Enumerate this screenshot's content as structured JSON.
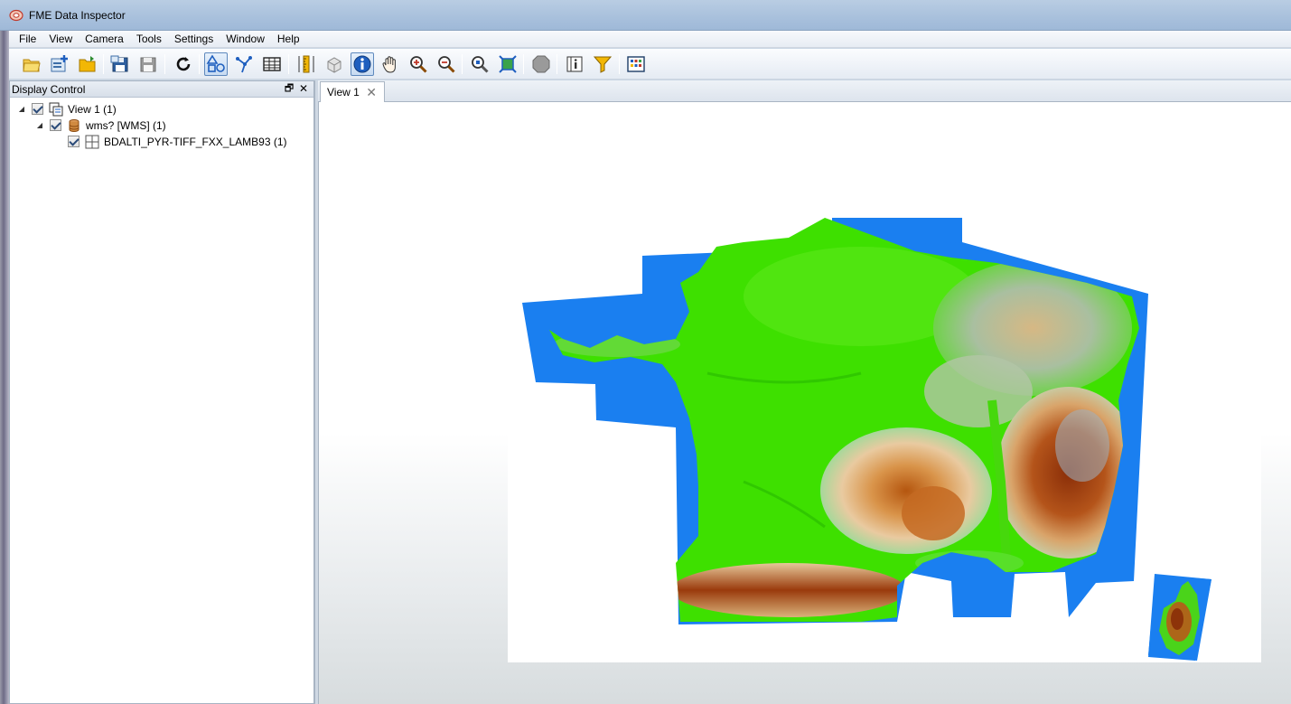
{
  "window": {
    "title": "FME Data Inspector"
  },
  "menu": {
    "items": [
      "File",
      "View",
      "Camera",
      "Tools",
      "Settings",
      "Window",
      "Help"
    ]
  },
  "toolbar": {
    "icons": [
      "open-folder-icon",
      "add-dataset-icon",
      "folder-icon",
      "save-icon",
      "save-disabled-icon",
      "refresh-icon",
      "select-shapes-icon",
      "select-vertex-icon",
      "table-view-icon",
      "measure-icon",
      "3d-view-icon",
      "info-icon",
      "pan-hand-icon",
      "zoom-in-icon",
      "zoom-out-icon",
      "zoom-selected-icon",
      "zoom-extents-icon",
      "stop-icon",
      "feature-info-icon",
      "filter-icon",
      "background-map-icon"
    ]
  },
  "display_control": {
    "title": "Display Control",
    "tree": [
      {
        "label": "View 1 (1)",
        "checked": true,
        "expanded": true,
        "icon": "view-icon"
      },
      {
        "label": "wms? [WMS] (1)",
        "checked": true,
        "expanded": true,
        "icon": "database-icon"
      },
      {
        "label": "BDALTI_PYR-TIFF_FXX_LAMB93 (1)",
        "checked": true,
        "icon": "raster-grid-icon"
      }
    ]
  },
  "view": {
    "tabs": [
      {
        "label": "View 1",
        "active": true
      }
    ]
  },
  "colors": {
    "ocean": "#1a7ff0",
    "lowland": "#3ee000",
    "midland": "#8fcf6a",
    "upland": "#d9b27a",
    "mountain": "#a3410f",
    "peak": "#9fb3c2"
  }
}
